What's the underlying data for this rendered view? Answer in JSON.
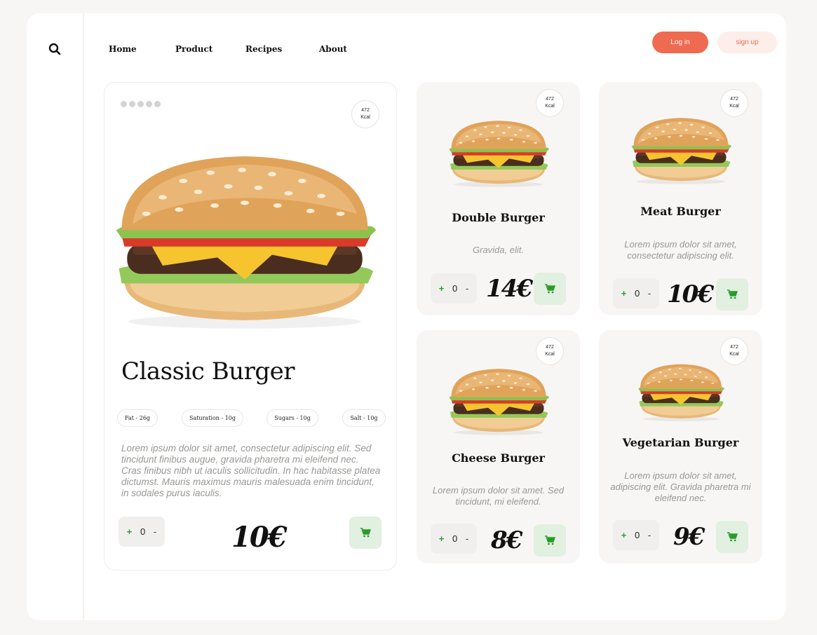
{
  "nav": {
    "home": "Home",
    "product": "Product",
    "recipes": "Recipes",
    "about": "About"
  },
  "auth": {
    "login": "Log in",
    "signup": "sign up"
  },
  "featured": {
    "kcal_value": "472",
    "kcal_unit": "Kcal",
    "title": "Classic Burger",
    "chips": [
      "Fat - 26g",
      "Saturation - 10g",
      "Sugars - 10g",
      "Salt - 10g"
    ],
    "description": "Lorem ipsum dolor sit amet, consectetur adipiscing elit. Sed tincidunt finibus augue, gravida pharetra mi eleifend nec. Cras finibus nibh ut iaculis sollicitudin. In hac habitasse platea dictumst. Mauris maximus mauris malesuada enim tincidunt, in sodales purus iaculis.",
    "qty": "0",
    "plus": "+",
    "minus": "-",
    "price": "10€"
  },
  "cards": [
    {
      "kcal_value": "472",
      "kcal_unit": "Kcal",
      "title": "Double Burger",
      "description": "Gravida, elit.",
      "qty": "0",
      "plus": "+",
      "minus": "-",
      "price": "14€"
    },
    {
      "kcal_value": "472",
      "kcal_unit": "Kcal",
      "title": "Meat Burger",
      "description": "Lorem ipsum dolor sit amet, consectetur adipiscing elit.",
      "qty": "0",
      "plus": "+",
      "minus": "-",
      "price": "10€"
    },
    {
      "kcal_value": "472",
      "kcal_unit": "Kcal",
      "title": "Cheese Burger",
      "description": "Lorem ipsum dolor sit amet. Sed tincidunt, mi eleifend.",
      "qty": "0",
      "plus": "+",
      "minus": "-",
      "price": "8€"
    },
    {
      "kcal_value": "472",
      "kcal_unit": "Kcal",
      "title": "Vegetarian Burger",
      "description": "Lorem ipsum dolor sit amet, adipiscing elit. Gravida pharetra mi eleifend nec.",
      "qty": "0",
      "plus": "+",
      "minus": "-",
      "price": "9€"
    }
  ],
  "colors": {
    "accent": "#ee6a50",
    "accent_light": "#fdeeea",
    "cart_bg": "#e1f0e1",
    "cart_icon": "#2a9b2a",
    "card_bg": "#f8f6f4"
  },
  "icons": {
    "search": "search-icon",
    "cart": "cart-icon"
  }
}
